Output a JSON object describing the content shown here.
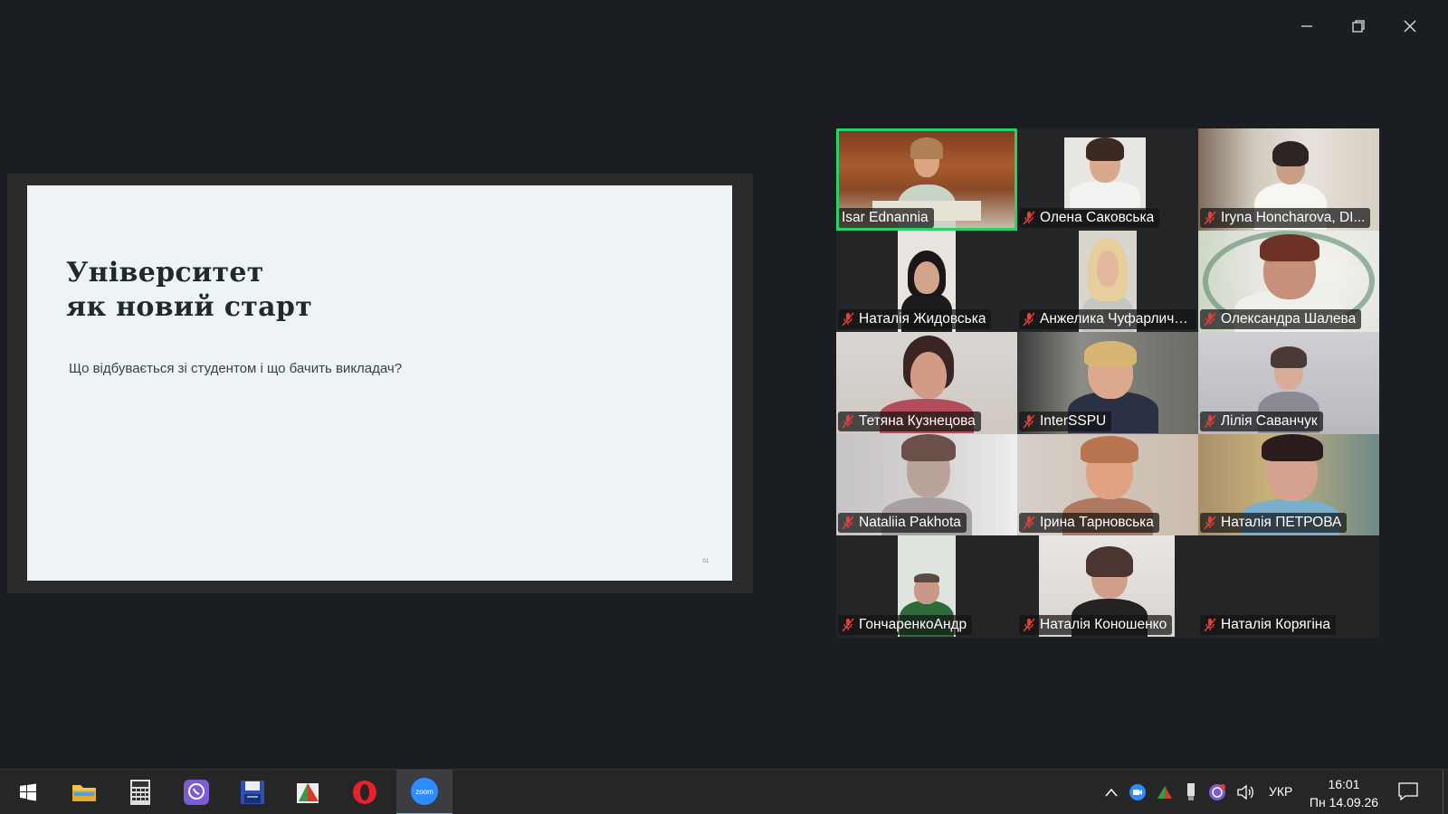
{
  "slide": {
    "title": "Університет\nяк новий старт",
    "subtitle": "Що відбувається зі студентом і що бачить викладач?",
    "page_number": "01"
  },
  "participants": [
    {
      "name": "Isar Ednannia",
      "muted": false,
      "active": true
    },
    {
      "name": "Олена Саковська",
      "muted": true
    },
    {
      "name": "Iryna Honcharova, DI...",
      "muted": true
    },
    {
      "name": "Наталія Жидовська",
      "muted": true
    },
    {
      "name": "Анжелика Чуфарличе...",
      "muted": true
    },
    {
      "name": "Олександра Шалева",
      "muted": true
    },
    {
      "name": "Тетяна Кузнецова",
      "muted": true
    },
    {
      "name": "InterSSPU",
      "muted": true
    },
    {
      "name": "Лілія Саванчук",
      "muted": true
    },
    {
      "name": "Nataliia Pakhota",
      "muted": true
    },
    {
      "name": "Ірина Тарновська",
      "muted": true
    },
    {
      "name": "Наталія ПЕТРОВА",
      "muted": true
    },
    {
      "name": "ГончаренкоАндр",
      "muted": true
    },
    {
      "name": "Наталія Коношенко",
      "muted": true
    },
    {
      "name": "Наталія Корягіна",
      "muted": true
    }
  ],
  "taskbar": {
    "apps": [
      "start-icon",
      "file-explorer-icon",
      "calculator-icon",
      "viber-icon",
      "save-disk-icon",
      "paint-app-icon",
      "opera-icon",
      "zoom-icon"
    ],
    "zoom_label": "zoom",
    "language": "УКР",
    "time": "16:01",
    "date": "Пн 14.09.26"
  },
  "colors": {
    "active_speaker_border": "#25d366",
    "mute_icon": "#e0413a",
    "zoom_blue": "#2d8cff"
  }
}
